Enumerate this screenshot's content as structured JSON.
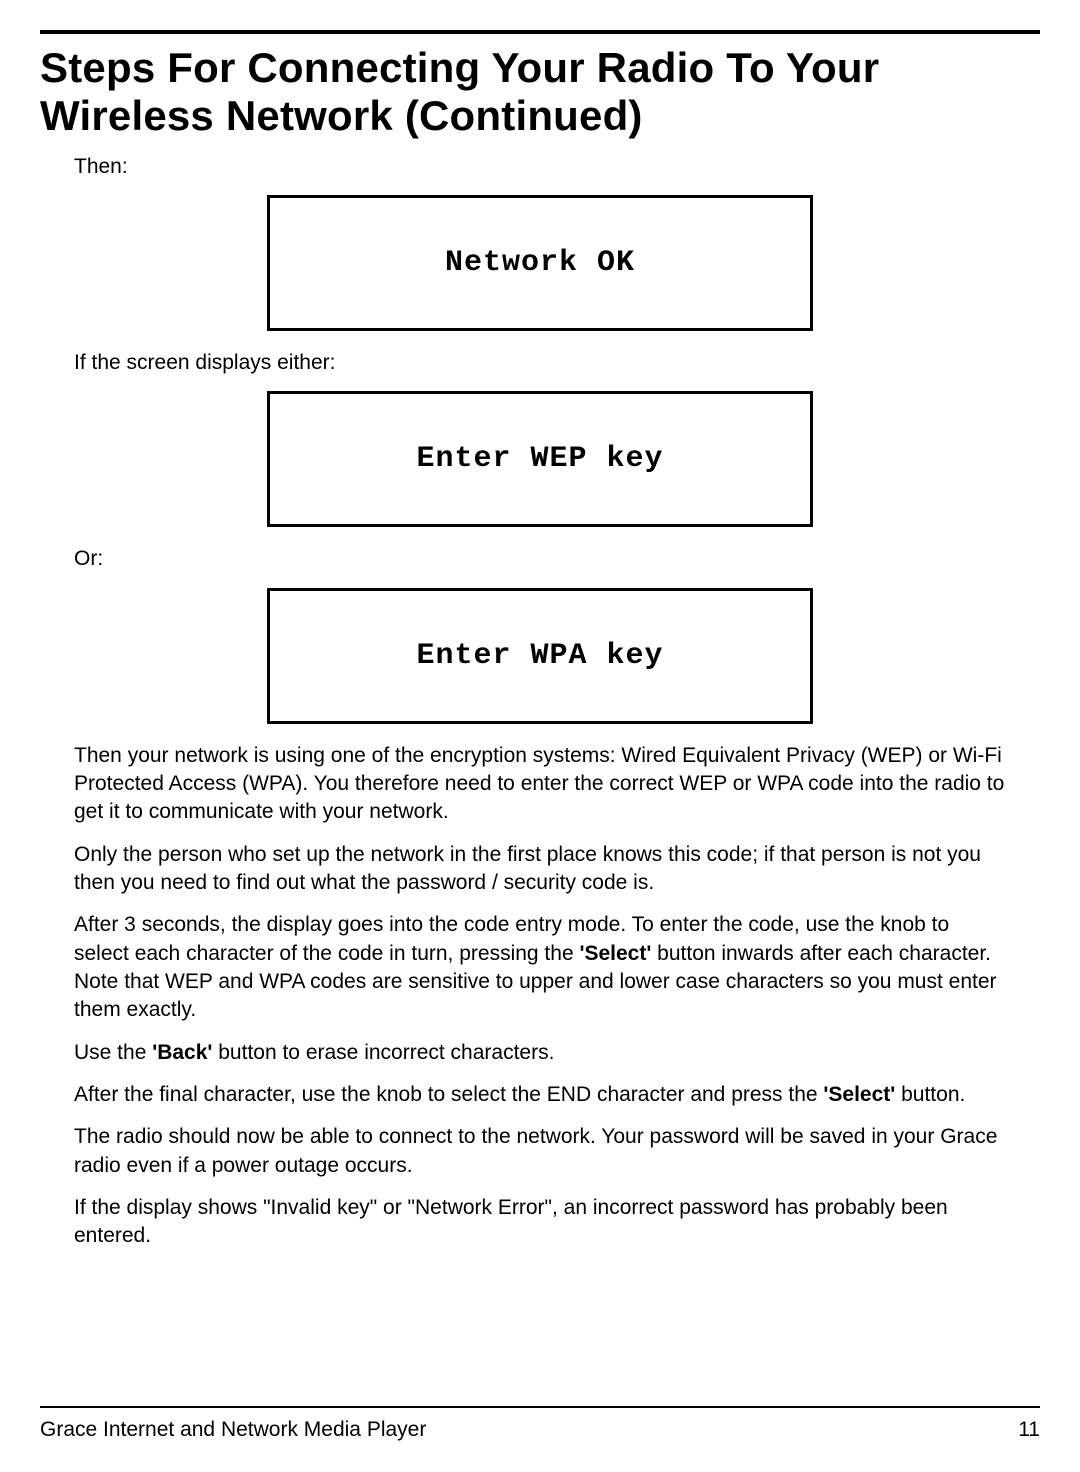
{
  "title": "Steps For Connecting Your Radio To Your Wireless Network (Continued)",
  "labels": {
    "then": "Then:",
    "if_screen": "If the screen displays either:",
    "or": "Or:"
  },
  "screens": {
    "network_ok": "Network OK",
    "enter_wep": "Enter WEP key",
    "enter_wpa": "Enter WPA key"
  },
  "paragraphs": {
    "p1": "Then your network is using one of the encryption systems:  Wired Equivalent Privacy (WEP) or Wi-Fi Protected Access (WPA). You therefore need to enter the correct WEP or WPA code into the radio to get it to communicate with your network.",
    "p2": "Only the person who set up the network in the first place knows this code; if that person is not you then you need to find out what the password / security code is.",
    "p3_a": "After 3 seconds, the display goes into the code entry mode. To enter the code, use the knob to select each character of the code in turn, pressing the ",
    "p3_select": "'Select'",
    "p3_b": " button inwards after each character. Note that WEP and WPA codes are sensitive to upper and lower case characters so you must enter them exactly.",
    "p4_a": "Use the ",
    "p4_back": "'Back'",
    "p4_b": " button to erase incorrect characters.",
    "p5_a": "After the final character, use the knob to select the END character and press the ",
    "p5_select": "'Select'",
    "p5_b": " button.",
    "p6": "The radio should now be able to connect to the network. Your password will be saved in your Grace radio even if a power outage occurs.",
    "p7": "If the display shows \"Invalid key\" or \"Network Error\", an incorrect password has probably been entered."
  },
  "footer": {
    "product": "Grace Internet and Network Media Player",
    "page_number": "11"
  }
}
